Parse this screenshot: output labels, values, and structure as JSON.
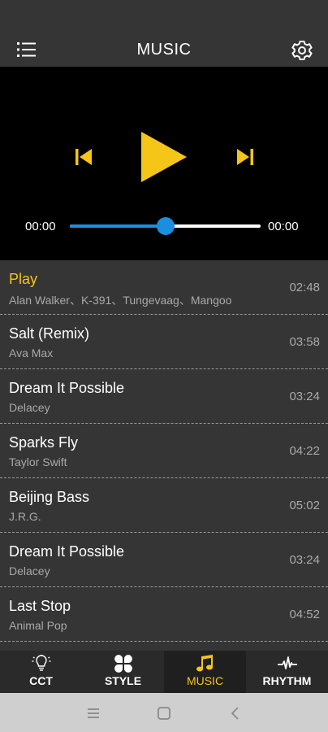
{
  "header": {
    "title": "MUSIC",
    "menu_icon": "list-icon",
    "settings_icon": "gear-icon"
  },
  "player": {
    "state": "paused",
    "current_time": "00:00",
    "total_time": "00:00",
    "progress_percent": 50,
    "accent_color": "#f5c518",
    "progress_color": "#1a8fe0"
  },
  "playlist": [
    {
      "title": "Play",
      "artist": "Alan Walker、K-391、Tungevaag、Mangoo",
      "duration": "02:48",
      "active": true
    },
    {
      "title": "Salt (Remix)",
      "artist": "Ava Max",
      "duration": "03:58"
    },
    {
      "title": "Dream It Possible",
      "artist": "Delacey",
      "duration": "03:24"
    },
    {
      "title": "Sparks Fly",
      "artist": "Taylor Swift",
      "duration": "04:22"
    },
    {
      "title": "Beijing Bass",
      "artist": "J.R.G.",
      "duration": "05:02"
    },
    {
      "title": "Dream It Possible",
      "artist": "Delacey",
      "duration": "03:24"
    },
    {
      "title": "Last Stop",
      "artist": "Animal Pop",
      "duration": "04:52"
    }
  ],
  "tabs": [
    {
      "label": "CCT",
      "icon": "bulb-icon"
    },
    {
      "label": "STYLE",
      "icon": "clover-icon"
    },
    {
      "label": "MUSIC",
      "icon": "music-note-icon",
      "active": true
    },
    {
      "label": "RHYTHM",
      "icon": "pulse-icon"
    }
  ],
  "system_nav": {
    "buttons": [
      "menu-icon",
      "home-icon",
      "back-icon"
    ]
  }
}
